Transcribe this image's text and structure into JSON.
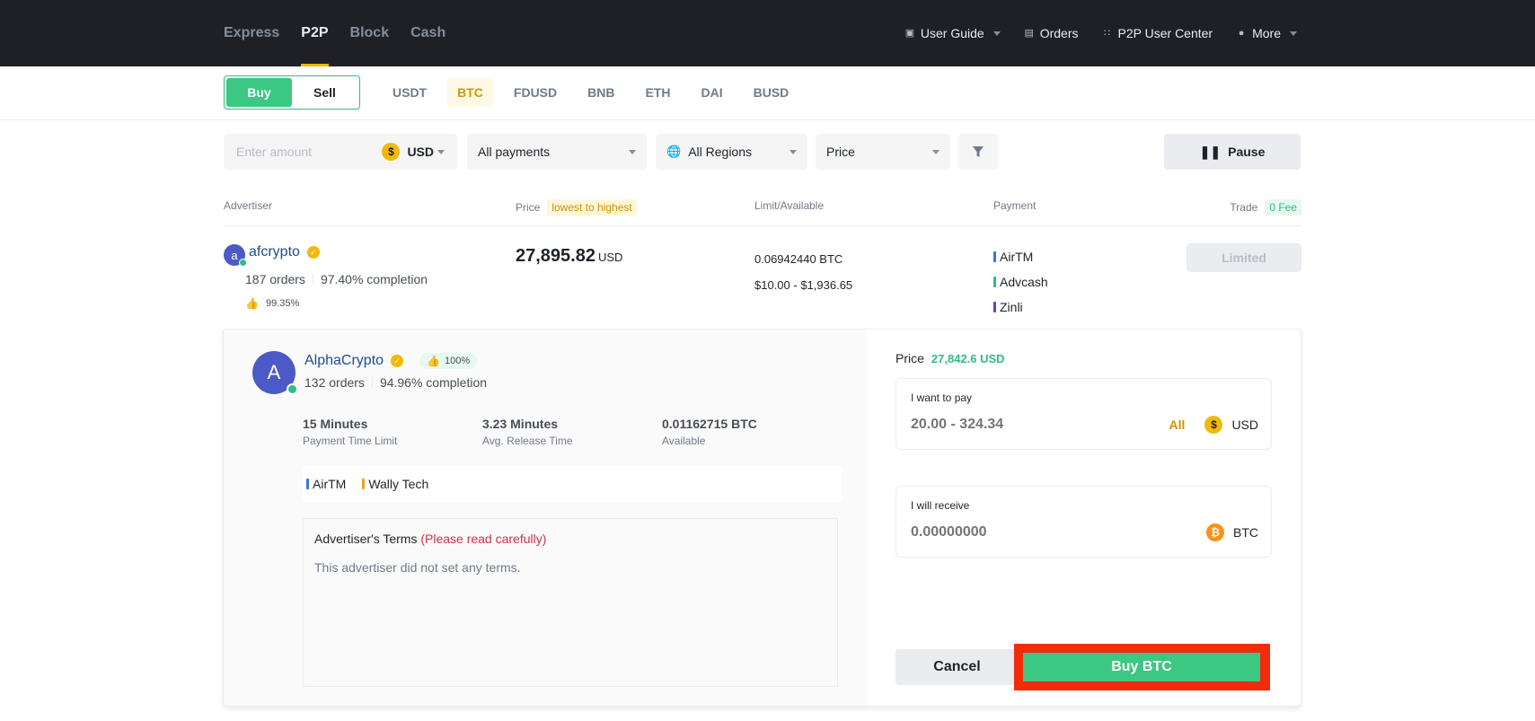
{
  "header": {
    "tabs": [
      {
        "label": "Express",
        "active": false
      },
      {
        "label": "P2P",
        "active": true
      },
      {
        "label": "Block",
        "active": false
      },
      {
        "label": "Cash",
        "active": false
      }
    ],
    "right_items": {
      "user_guide": "User Guide",
      "orders": "Orders",
      "p2p_user_center": "P2P User Center",
      "more": "More"
    },
    "accent_color": "#f0b90b"
  },
  "trade_side": {
    "buy": "Buy",
    "sell": "Sell",
    "selected": "Buy"
  },
  "coins": [
    "USDT",
    "BTC",
    "FDUSD",
    "BNB",
    "ETH",
    "DAI",
    "BUSD"
  ],
  "selected_coin": "BTC",
  "filters": {
    "amount_placeholder": "Enter amount",
    "currency": "USD",
    "payments": "All payments",
    "regions": "All Regions",
    "sort": "Price",
    "pause_label": "Pause"
  },
  "table": {
    "headers": {
      "advertiser": "Advertiser",
      "price": "Price",
      "price_tag": "lowest to highest",
      "limit": "Limit/Available",
      "payment": "Payment",
      "trade": "Trade",
      "trade_tag": "0 Fee"
    },
    "rows": [
      {
        "avatar_letter": "a",
        "name": "afcrypto",
        "orders": "187 orders",
        "completion": "97.40% completion",
        "rating": "99.35%",
        "price": "27,895.82",
        "price_currency": "USD",
        "available": "0.06942440 BTC",
        "limit": "$10.00 - $1,936.65",
        "payments": [
          {
            "name": "AirTM",
            "color": "#3375e0"
          },
          {
            "name": "Advcash",
            "color": "#2ebd85"
          },
          {
            "name": "Zinli",
            "color": "#6a3fc1"
          }
        ],
        "action": "Limited"
      }
    ]
  },
  "expanded": {
    "avatar_letter": "A",
    "name": "AlphaCrypto",
    "like_rate": "100%",
    "orders": "132 orders",
    "completion": "94.96% completion",
    "info": [
      {
        "value": "15 Minutes",
        "label": "Payment Time Limit"
      },
      {
        "value": "3.23 Minutes",
        "label": "Avg. Release Time"
      },
      {
        "value": "0.01162715 BTC",
        "label": "Available"
      }
    ],
    "payments": [
      {
        "name": "AirTM",
        "color": "#3375e0"
      },
      {
        "name": "Wally Tech",
        "color": "#f0a020"
      }
    ],
    "terms_title": "Advertiser's Terms",
    "terms_warning": "(Please read carefully)",
    "terms_body": "This advertiser did not set any terms.",
    "price_label": "Price",
    "price_value": "27,842.6 USD",
    "pay": {
      "label": "I want to pay",
      "placeholder": "20.00 - 324.34",
      "all": "All",
      "currency": "USD"
    },
    "receive": {
      "label": "I will receive",
      "placeholder": "0.00000000",
      "currency": "BTC"
    },
    "cancel_label": "Cancel",
    "buy_label": "Buy BTC"
  }
}
